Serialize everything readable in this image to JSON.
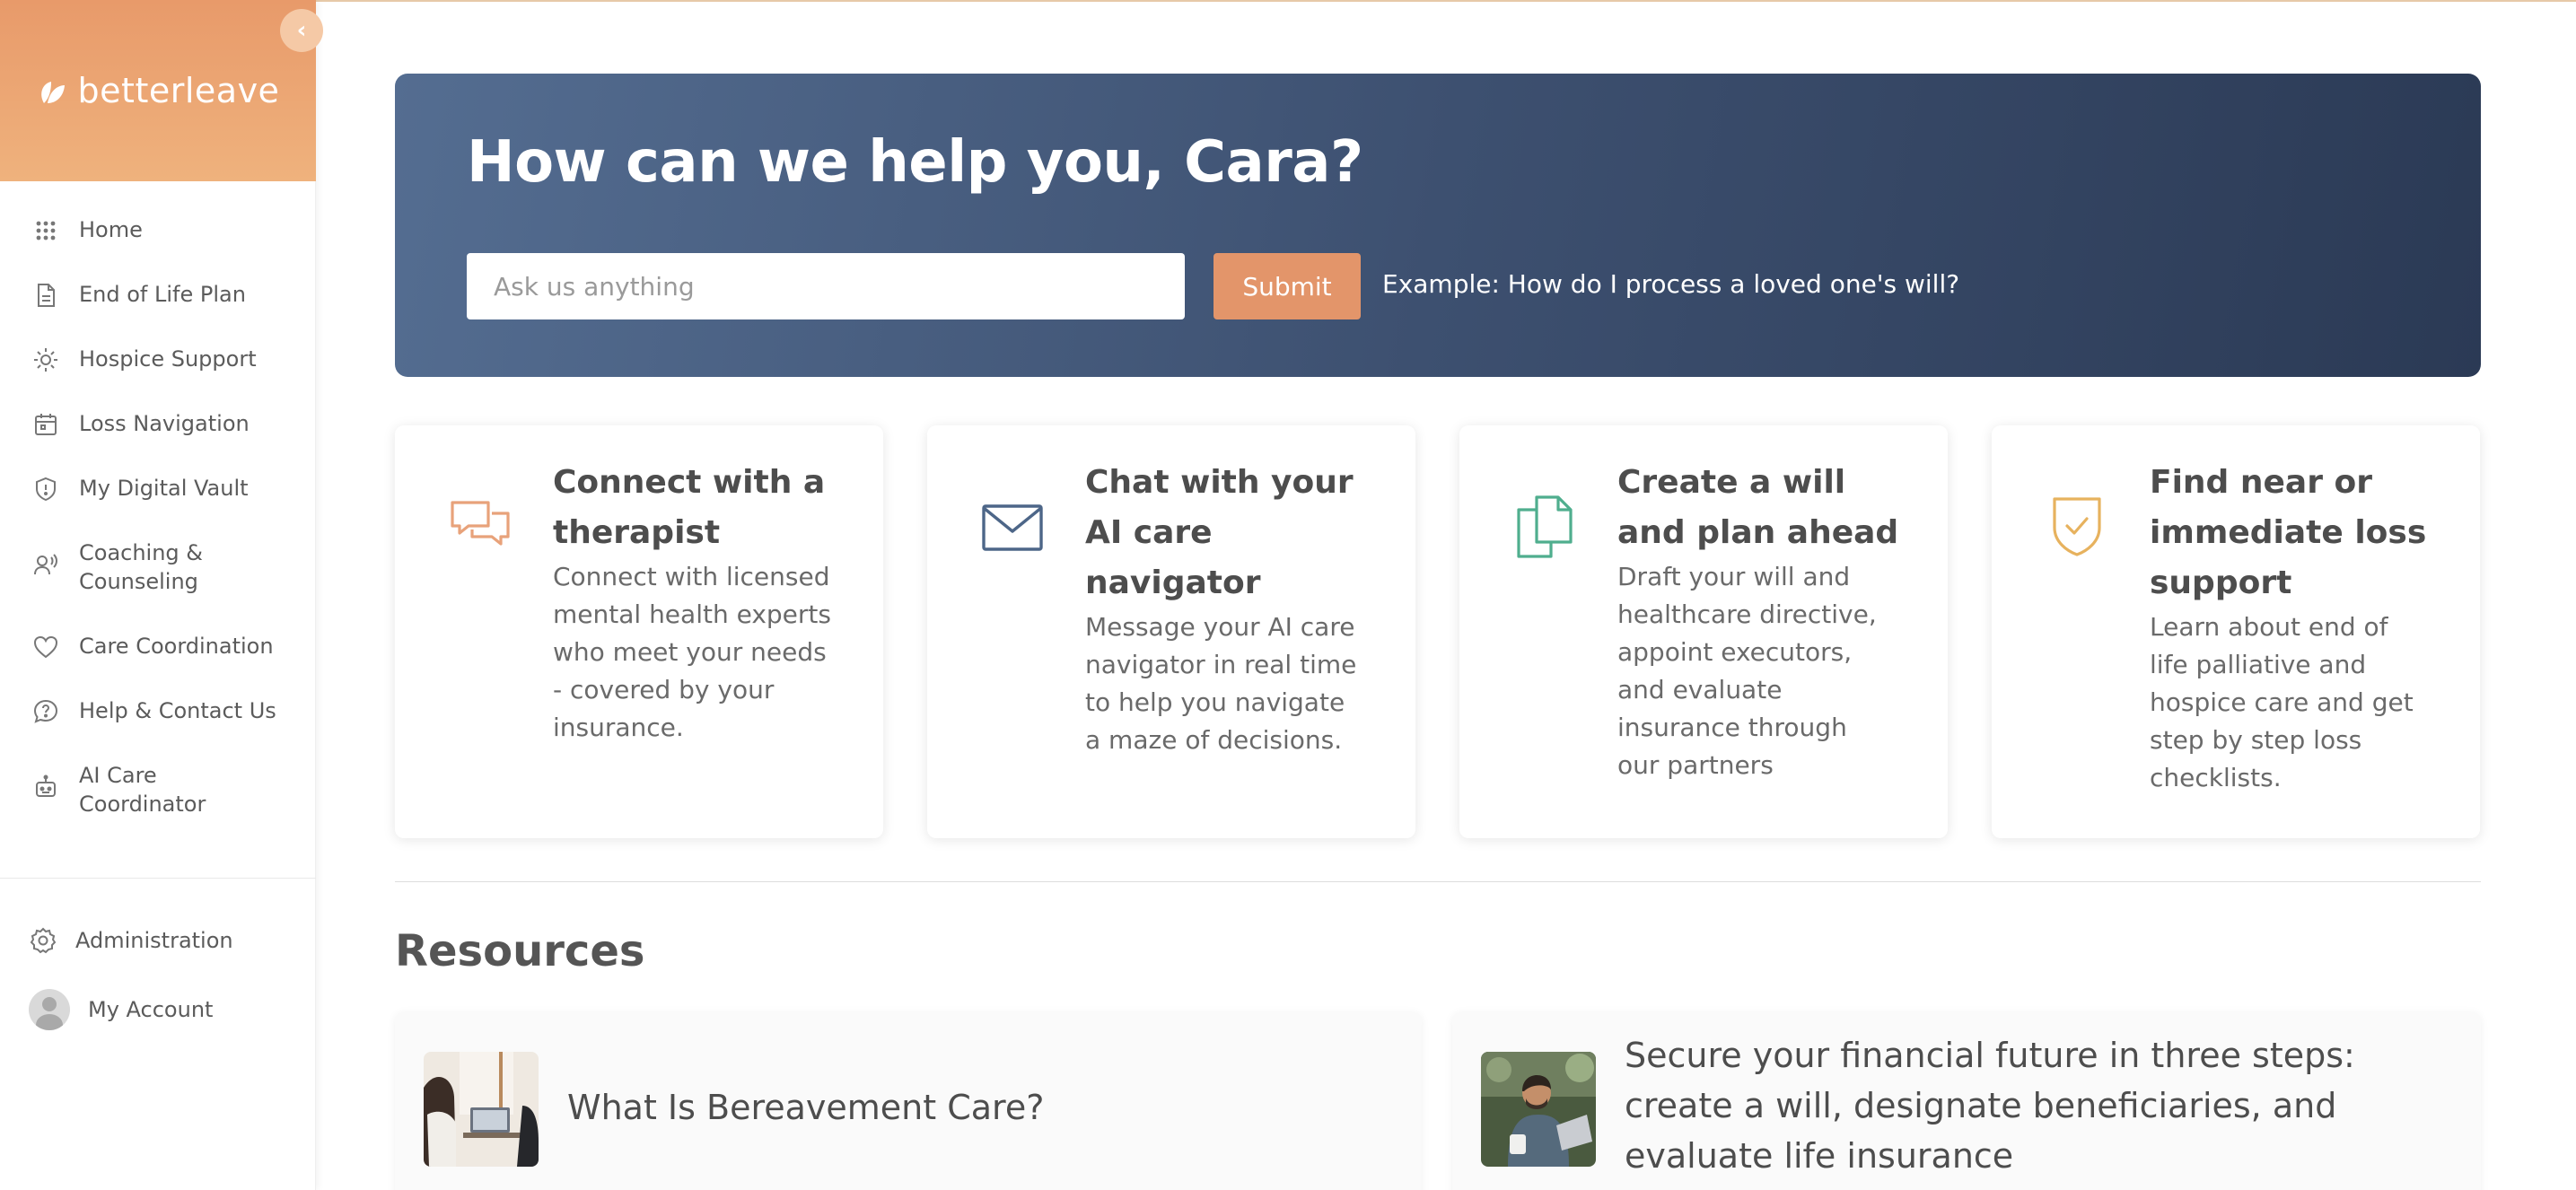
{
  "brand": {
    "name": "betterleave",
    "accent": "#e89a6a"
  },
  "sidebar": {
    "items": [
      {
        "label": "Home",
        "icon": "grid-icon"
      },
      {
        "label": "End of Life Plan",
        "icon": "document-icon"
      },
      {
        "label": "Hospice Support",
        "icon": "sun-icon"
      },
      {
        "label": "Loss Navigation",
        "icon": "calendar-icon"
      },
      {
        "label": "My Digital Vault",
        "icon": "shield-icon"
      },
      {
        "label": "Coaching & Counseling",
        "icon": "person-voice-icon"
      },
      {
        "label": "Care Coordination",
        "icon": "heart-icon"
      },
      {
        "label": "Help & Contact Us",
        "icon": "question-icon"
      },
      {
        "label": "AI Care Coordinator",
        "icon": "robot-icon"
      }
    ],
    "admin_label": "Administration",
    "account_label": "My Account"
  },
  "hero": {
    "title": "How can we help you, Cara?",
    "search_placeholder": "Ask us anything",
    "submit_label": "Submit",
    "example": "Example: How do I process a loved one's will?"
  },
  "cards": [
    {
      "title": "Connect with a therapist",
      "description": "Connect with licensed mental health experts who meet your needs - covered by your insurance.",
      "icon": "chat-bubbles-icon",
      "icon_color": "#e8a27a"
    },
    {
      "title": "Chat with your AI care navigator",
      "description": "Message your AI care navigator in real time to help you navigate a maze of decisions.",
      "icon": "envelope-icon",
      "icon_color": "#4d6688"
    },
    {
      "title": "Create a will and plan ahead",
      "description": "Draft your will and healthcare directive, appoint executors, and evaluate insurance through our partners",
      "icon": "documents-icon",
      "icon_color": "#4fae8e"
    },
    {
      "title": "Find near or immediate loss support",
      "description": "Learn about end of life palliative and hospice care and get step by step loss checklists.",
      "icon": "shield-check-icon",
      "icon_color": "#e7b25e"
    }
  ],
  "resources": {
    "heading": "Resources",
    "items": [
      {
        "title": "What Is Bereavement Care?"
      },
      {
        "title": "Secure your financial future in three steps: create a will, designate beneficiaries, and evaluate life insurance"
      }
    ]
  }
}
